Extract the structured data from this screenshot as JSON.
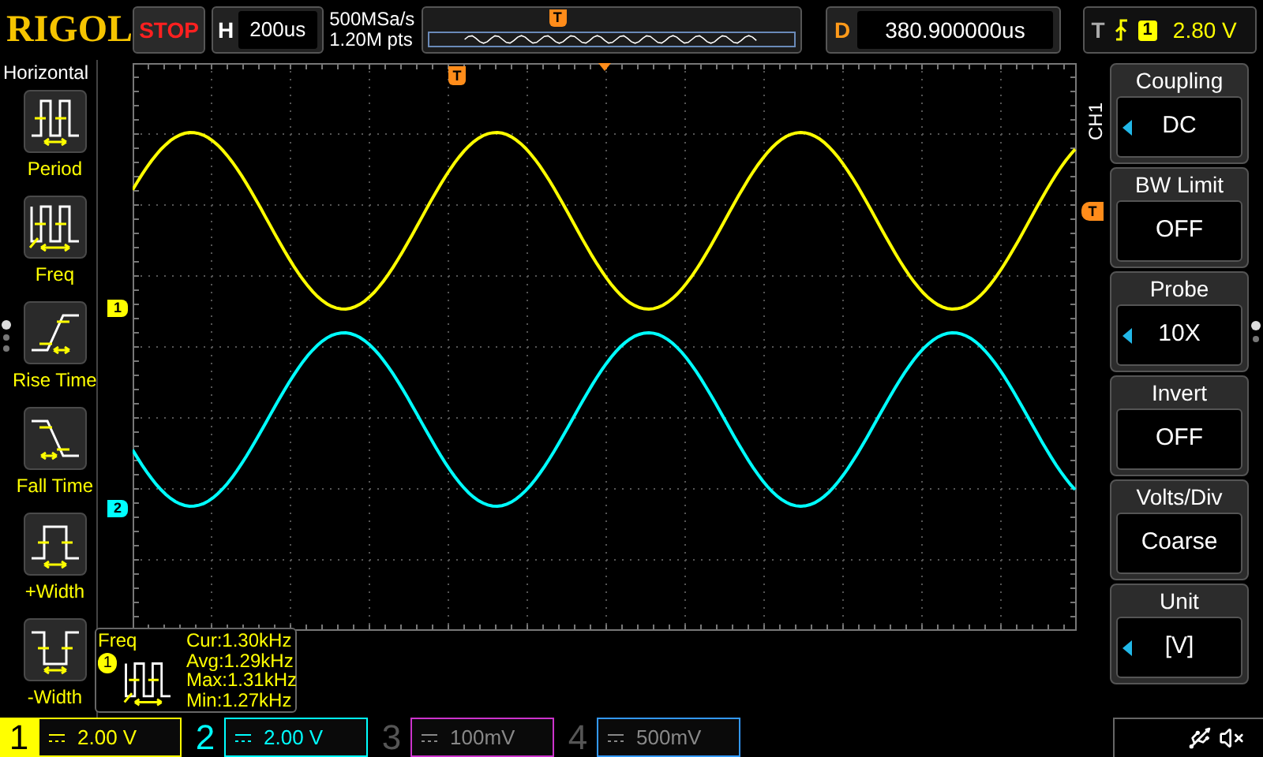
{
  "top_bar": {
    "logo": "RIGOL",
    "run_state": "STOP",
    "horizontal": {
      "label": "H",
      "value": "200us"
    },
    "sample_rate": "500MSa/s",
    "memory_depth": "1.20M pts",
    "overview_marker": "T",
    "delay": {
      "label": "D",
      "value": "380.900000us"
    },
    "trigger": {
      "label": "T",
      "source": "1",
      "level": "2.80 V"
    }
  },
  "left_panel": {
    "title": "Horizontal",
    "items": [
      {
        "label": "Period",
        "kind": "period"
      },
      {
        "label": "Freq",
        "kind": "freq"
      },
      {
        "label": "Rise Time",
        "kind": "rise"
      },
      {
        "label": "Fall Time",
        "kind": "fall"
      },
      {
        "label": "+Width",
        "kind": "pwidth"
      },
      {
        "label": "-Width",
        "kind": "nwidth"
      }
    ]
  },
  "screen": {
    "channel_markers": [
      {
        "label": "1",
        "color": "#ffff00"
      },
      {
        "label": "2",
        "color": "#00ffff"
      }
    ],
    "trigger_position_marker": "T",
    "trigger_level_marker": "T"
  },
  "measurement": {
    "name": "Freq",
    "source": "1",
    "lines": [
      "Cur:1.30kHz",
      "Avg:1.29kHz",
      "Max:1.31kHz",
      "Min:1.27kHz"
    ]
  },
  "right_panel": {
    "title": "CH1",
    "items": [
      {
        "label": "Coupling",
        "value": "DC",
        "kind": "knob"
      },
      {
        "label": "BW Limit",
        "value": "OFF",
        "kind": "toggle"
      },
      {
        "label": "Probe",
        "value": "10X",
        "kind": "knob"
      },
      {
        "label": "Invert",
        "value": "OFF",
        "kind": "toggle"
      },
      {
        "label": "Volts/Div",
        "value": "Coarse",
        "kind": "toggle"
      },
      {
        "label": "Unit",
        "value": "[V]",
        "kind": "knob"
      }
    ]
  },
  "channels": [
    {
      "number": "1",
      "scale": "2.00 V",
      "color": "#ffff00",
      "selected": true,
      "on": true
    },
    {
      "number": "2",
      "scale": "2.00 V",
      "color": "#00ffff",
      "selected": false,
      "on": true
    },
    {
      "number": "3",
      "scale": "100mV",
      "color": "#cc33cc",
      "selected": false,
      "on": false
    },
    {
      "number": "4",
      "scale": "500mV",
      "color": "#3399ff",
      "selected": false,
      "on": false
    }
  ]
}
